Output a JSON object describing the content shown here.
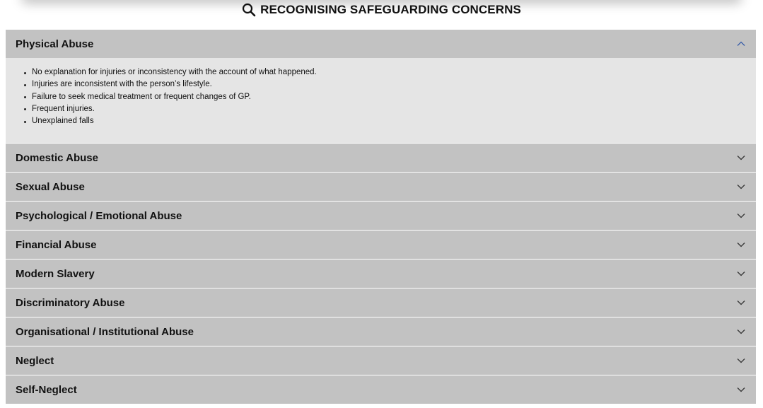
{
  "page": {
    "title": "RECOGNISING SAFEGUARDING CONCERNS",
    "title_icon": "search-icon"
  },
  "accordion": {
    "expanded_index": 0,
    "items": [
      {
        "label": "Physical Abuse",
        "expanded": true,
        "bullets": [
          "No explanation for injuries or inconsistency with the account of what happened.",
          "Injuries are inconsistent with the person’s lifestyle.",
          "Failure to seek medical treatment or frequent changes of GP.",
          "Frequent injuries.",
          "Unexplained falls"
        ]
      },
      {
        "label": "Domestic Abuse",
        "expanded": false
      },
      {
        "label": "Sexual Abuse",
        "expanded": false
      },
      {
        "label": "Psychological / Emotional Abuse",
        "expanded": false
      },
      {
        "label": "Financial Abuse",
        "expanded": false
      },
      {
        "label": "Modern Slavery",
        "expanded": false
      },
      {
        "label": "Discriminatory Abuse",
        "expanded": false
      },
      {
        "label": "Organisational / Institutional Abuse",
        "expanded": false
      },
      {
        "label": "Neglect",
        "expanded": false
      },
      {
        "label": "Self-Neglect",
        "expanded": false
      }
    ]
  },
  "colors": {
    "header_bg": "#c2c2c2",
    "body_bg": "#e5e5e5",
    "chevron_up": "#3a5ea8",
    "chevron_down": "#333333"
  }
}
